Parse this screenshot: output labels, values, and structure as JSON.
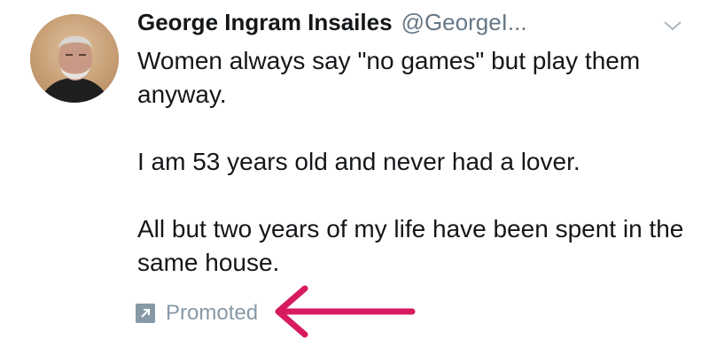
{
  "tweet": {
    "author": {
      "display_name": "George Ingram Insailes",
      "handle": "@GeorgeI...",
      "avatar_icon": "user-photo"
    },
    "menu_icon": "chevron-down-icon",
    "paragraphs": [
      "Women always say \"no games\" but play them anyway.",
      "I am 53 years old and never had a lover.",
      "All but two years of my life have been spent in the same house."
    ],
    "promoted": {
      "label": "Promoted",
      "icon": "promoted-arrow-icon"
    }
  },
  "annotation": {
    "arrow_color": "#d81b60"
  }
}
